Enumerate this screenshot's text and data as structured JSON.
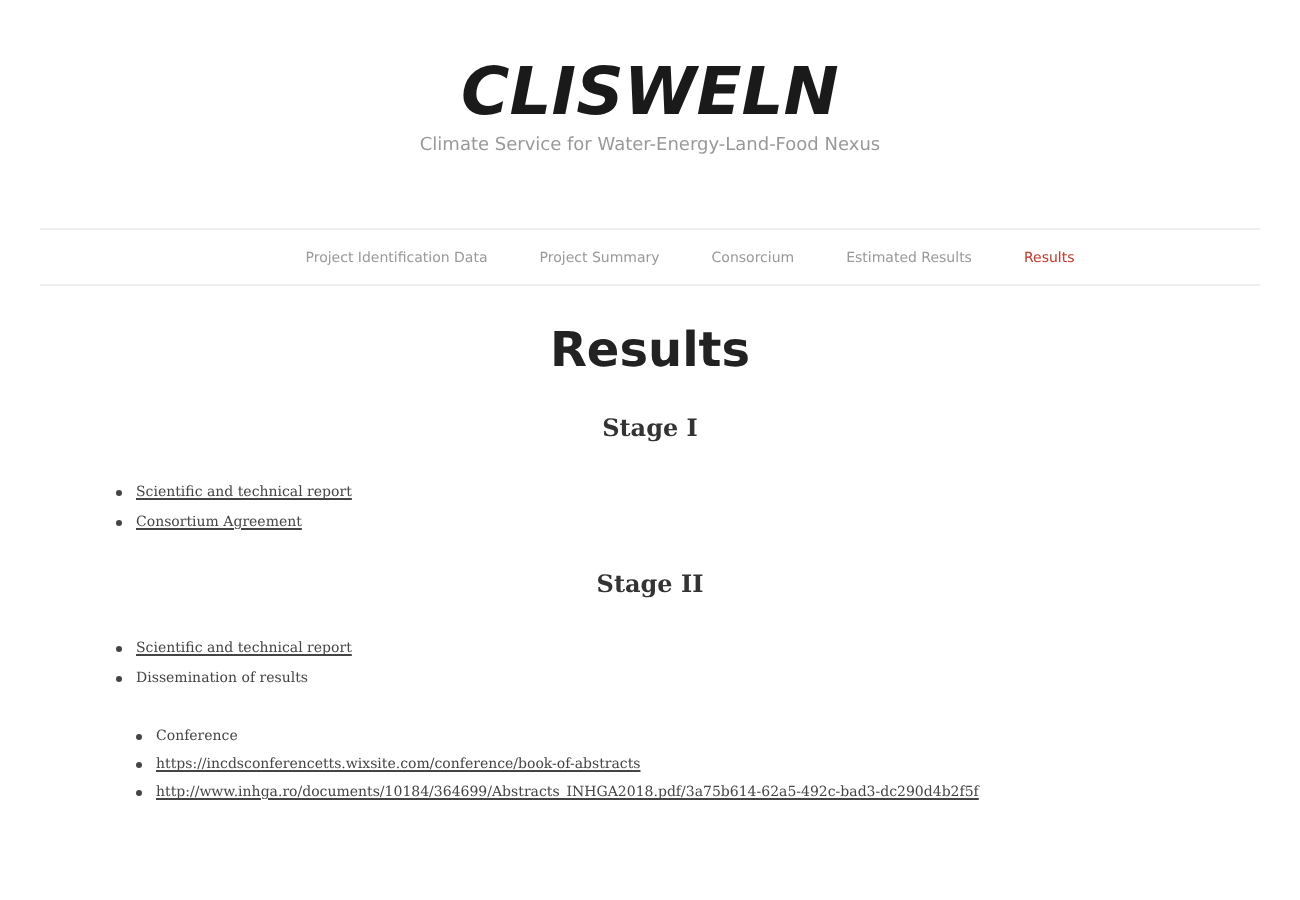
{
  "site": {
    "title": "CLISWELN",
    "tagline": "Climate Service for Water-Energy-Land-Food Nexus"
  },
  "nav": [
    {
      "label": "Project Identification Data",
      "selected": false
    },
    {
      "label": "Project Summary",
      "selected": false
    },
    {
      "label": "Consorcium",
      "selected": false
    },
    {
      "label": "Estimated Results",
      "selected": false
    },
    {
      "label": "Results",
      "selected": true
    }
  ],
  "page_title": "Results",
  "sections": [
    {
      "heading": "Stage I",
      "items": [
        {
          "text": "Scientific and technical report",
          "kind": "link"
        },
        {
          "text": "Consortium Agreement",
          "kind": "link"
        }
      ]
    },
    {
      "heading": "Stage II",
      "items": [
        {
          "text": "Scientific and technical report",
          "kind": "link"
        },
        {
          "text": "Dissemination of results",
          "kind": "text",
          "children": [
            {
              "text": "Conference",
              "kind": "text"
            },
            {
              "text": "https://incdsconferencetts.wixsite.com/conference/book-of-abstracts",
              "kind": "link"
            },
            {
              "text": "http://www.inhga.ro/documents/10184/364699/Abstracts_INHGA2018.pdf/3a75b614-62a5-492c-bad3-dc290d4b2f5f",
              "kind": "link"
            }
          ]
        }
      ]
    }
  ]
}
